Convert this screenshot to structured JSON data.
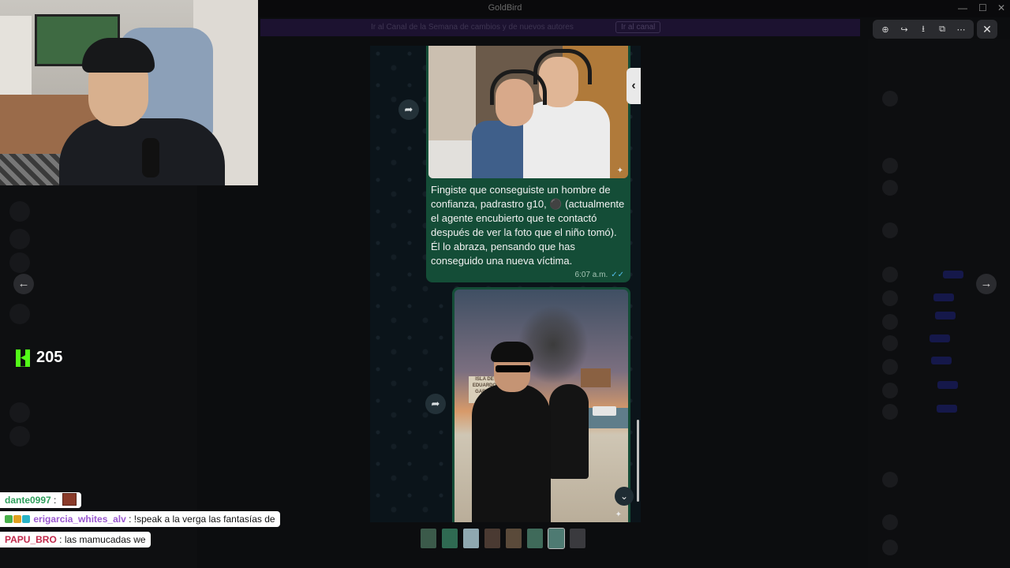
{
  "window": {
    "title": "GoldBird"
  },
  "banner": {
    "text": "Ir al Canal de la Semana de cambios y de nuevos autores",
    "button": "Ir al canal"
  },
  "stream": {
    "viewer_count": "205",
    "chat": [
      {
        "user": "dante0997",
        "sep": ":",
        "message": "",
        "user_color": "#2e9e5b"
      },
      {
        "user": "erigarcia_whites_alv",
        "sep": ":",
        "message": "!speak a la verga las fantasías de",
        "user_color": "#9b59d0"
      },
      {
        "user": "PAPU_BRO",
        "sep": ":",
        "message": "las mamucadas we",
        "user_color": "#c0284a"
      }
    ]
  },
  "viewer": {
    "toolbar_icons": [
      "zoom-in-icon",
      "reply-icon",
      "download-icon",
      "external-open-icon",
      "more-icon"
    ],
    "close_icon": "close-icon"
  },
  "message": {
    "caption": "Fingiste que conseguiste un hombre de confianza, padrastro g10, ⚫ (actualmente el agente encubierto que te contactó después de ver la foto que el niño tomó). Él lo abraza, pensando que has conseguido una nueva víctima.",
    "time": "6:07 a.m.",
    "ticks": "✓✓",
    "sign_text": "ISLA DE EDUARDO GARCIA"
  },
  "thumbnails": {
    "count": 8
  },
  "colors": {
    "kick_green": "#53fc18",
    "bubble_green": "#144d37",
    "read_tick": "#53bdeb"
  }
}
